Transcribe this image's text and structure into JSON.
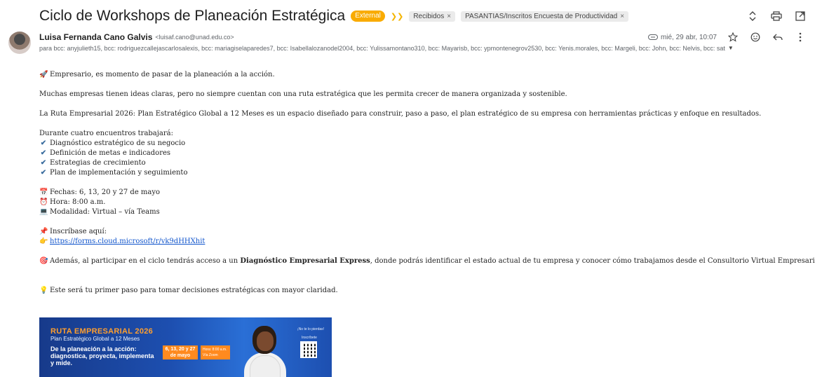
{
  "subject": {
    "title": "Ciclo de Workshops de Planeación Estratégica",
    "badge": "External",
    "labels": [
      {
        "name": "Recibidos",
        "remove": "×"
      },
      {
        "name": "PASANTIAS/Inscritos Encuesta de Productividad",
        "remove": "×"
      }
    ],
    "tools": [
      "expand-collapse-icon",
      "print-icon",
      "open-new-window-icon"
    ]
  },
  "sender": {
    "name": "Luisa Fernanda Cano Galvis",
    "email": "<luisaf.cano@unad.edu.co>",
    "date": "mié, 29 abr, 10:07",
    "recipients": "para bcc: anyjulieth15, bcc: rodriguezcallejascarlosalexis, bcc: mariagiselaparedes7, bcc: Isabellalozanodel2004, bcc: Yulissamontano310, bcc: Mayarisb, bcc: ypmontenegrov2530, bcc: Yenis.morales, bcc: Margeli, bcc: John, bcc: Nelvis, bcc: sat"
  },
  "body": {
    "intro": "Empresario, es momento de pasar de la planeación a la acción.",
    "p1": "Muchas empresas tienen ideas claras, pero no siempre cuentan con una ruta estratégica que les permita crecer de manera organizada y sostenible.",
    "p2": "La Ruta Empresarial 2026: Plan Estratégico Global a 12 Meses es un espacio diseñado para construir, paso a paso, el plan estratégico de su empresa con herramientas prácticas y enfoque en resultados.",
    "list_title": "Durante cuatro encuentros trabajará:",
    "list": [
      "Diagnóstico estratégico de su negocio",
      "Definición de metas e indicadores",
      "Estrategias de crecimiento",
      "Plan de implementación y seguimiento"
    ],
    "dates": "Fechas: 6, 13, 20 y 27 de mayo",
    "time": "Hora: 8:00 a.m.",
    "mode": "Modalidad: Virtual – vía Teams",
    "signup_label": "Inscríbase aquí:",
    "signup_link": "https://forms.cloud.microsoft/r/vk9dHHXhit",
    "extra_pre": "Además, al participar en el ciclo tendrás acceso a un ",
    "extra_bold": "Diagnóstico Empresarial Express",
    "extra_post": ", donde podrás identificar el estado actual de tu empresa y conocer cómo trabajamos desde el Consultorio Virtual Empresarial.",
    "closing": "Este será tu primer paso para tomar decisiones estratégicas con mayor claridad."
  },
  "banner": {
    "title": "RUTA EMPRESARIAL 2026",
    "subtitle": "Plan Estratégico Global a 12 Meses",
    "headline": "De la planeación a la acción: diagnostica, proyecta, implementa y mide.",
    "dates": "6, 13, 20 y 27 de mayo",
    "time": "Hora: 8:00 a.m. Vía Zoom",
    "right_top": "¡No te lo pierdas!",
    "right_label": "Inscríbete"
  }
}
